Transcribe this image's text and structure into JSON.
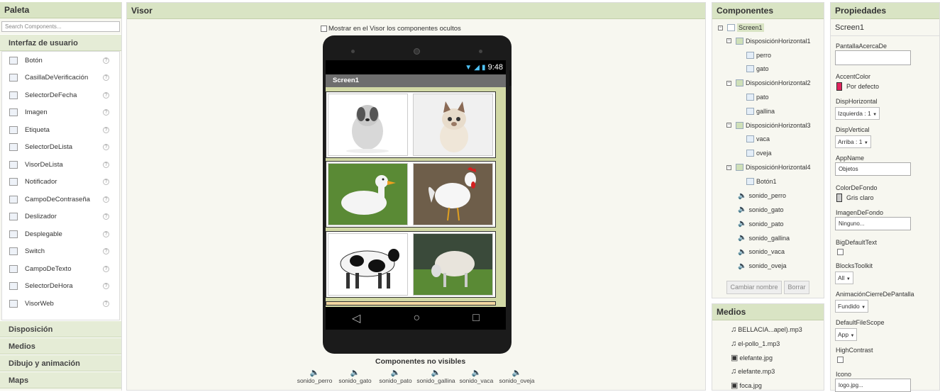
{
  "palette": {
    "title": "Paleta",
    "search_placeholder": "Search Components...",
    "category_ui": "Interfaz de usuario",
    "items": [
      "Botón",
      "CasillaDeVerificación",
      "SelectorDeFecha",
      "Imagen",
      "Etiqueta",
      "SelectorDeLista",
      "VisorDeLista",
      "Notificador",
      "CampoDeContraseña",
      "Deslizador",
      "Desplegable",
      "Switch",
      "CampoDeTexto",
      "SelectorDeHora",
      "VisorWeb"
    ],
    "categories": [
      "Disposición",
      "Medios",
      "Dibujo y animación",
      "Maps"
    ]
  },
  "visor": {
    "title": "Visor",
    "hidden_checkbox_label": "Mostrar en el Visor los componentes ocultos",
    "time": "9:48",
    "screen_title": "Screen1",
    "nonvisible_title": "Componentes no visibles",
    "nonvisible": [
      "sonido_perro",
      "sonido_gato",
      "sonido_pato",
      "sonido_gallina",
      "sonido_vaca",
      "sonido_oveja"
    ]
  },
  "components": {
    "title": "Componentes",
    "tree": [
      {
        "label": "Screen1"
      },
      {
        "label": "DisposiciónHorizontal1"
      },
      {
        "label": "perro"
      },
      {
        "label": "gato"
      },
      {
        "label": "DisposiciónHorizontal2"
      },
      {
        "label": "pato"
      },
      {
        "label": "gallina"
      },
      {
        "label": "DisposiciónHorizontal3"
      },
      {
        "label": "vaca"
      },
      {
        "label": "oveja"
      },
      {
        "label": "DisposiciónHorizontal4"
      },
      {
        "label": "Botón1"
      },
      {
        "label": "sonido_perro"
      },
      {
        "label": "sonido_gato"
      },
      {
        "label": "sonido_pato"
      },
      {
        "label": "sonido_gallina"
      },
      {
        "label": "sonido_vaca"
      },
      {
        "label": "sonido_oveja"
      }
    ],
    "rename_button": "Cambiar nombre",
    "delete_button": "Borrar"
  },
  "media": {
    "title": "Medios",
    "items": [
      "BELLACIA...apel).mp3",
      "el-pollo_1.mp3",
      "elefante.jpg",
      "elefante.mp3",
      "foca.jpg"
    ]
  },
  "properties": {
    "title": "Propiedades",
    "component": "Screen1",
    "about_label": "PantallaAcercaDe",
    "accent_label": "AccentColor",
    "accent_value": "Por defecto",
    "accent_color": "#e0245e",
    "halign_label": "DispHorizontal",
    "halign_value": "Izquierda : 1",
    "valign_label": "DispVertical",
    "valign_value": "Arriba : 1",
    "appname_label": "AppName",
    "appname_value": "Objetos",
    "bgcolor_label": "ColorDeFondo",
    "bgcolor_value": "Gris claro",
    "bgcolor_color": "#cccccc",
    "bgimage_label": "ImagenDeFondo",
    "bgimage_value": "Ninguno...",
    "bigtext_label": "BigDefaultText",
    "blocks_label": "BlocksToolkit",
    "blocks_value": "All",
    "closeanim_label": "AnimaciónCierreDePantalla",
    "closeanim_value": "Fundido",
    "filescope_label": "DefaultFileScope",
    "filescope_value": "App",
    "contrast_label": "HighContrast",
    "icon_label": "Icono",
    "icon_value": "logo.jpg..."
  }
}
